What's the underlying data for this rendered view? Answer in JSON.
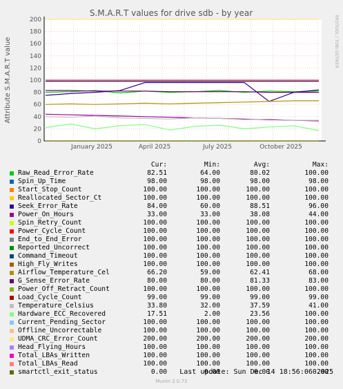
{
  "chart_data": {
    "type": "line",
    "title": "S.M.A.R.T values for drive sdb - by year",
    "ylabel": "Attribute S.M.A.R.T value",
    "ylim": [
      0,
      200
    ],
    "yticks": [
      "0",
      "20",
      "40",
      "60",
      "80",
      "100",
      "120",
      "140",
      "160",
      "180",
      "200"
    ],
    "xticks": [
      "January 2025",
      "April 2025",
      "July 2025",
      "October 2025"
    ],
    "grid": true,
    "side_text": "RRDTOOL / TOBI OETIKER",
    "series": [
      {
        "name": "Raw_Read_Error_Rate",
        "color": "#00cc00",
        "cur": "82.51",
        "min": "64.00",
        "avg": "80.02",
        "max": "100.00",
        "values": [
          80,
          81,
          83,
          79,
          82,
          80,
          81,
          83,
          80,
          82,
          81,
          82
        ]
      },
      {
        "name": "Spin_Up_Time",
        "color": "#0066b3",
        "cur": "98.00",
        "min": "98.00",
        "avg": "98.00",
        "max": "98.00",
        "values": [
          98,
          98,
          98,
          98,
          98,
          98,
          98,
          98,
          98,
          98,
          98,
          98
        ]
      },
      {
        "name": "Start_Stop_Count",
        "color": "#ff8000",
        "cur": "100.00",
        "min": "100.00",
        "avg": "100.00",
        "max": "100.00",
        "values": [
          100,
          100,
          100,
          100,
          100,
          100,
          100,
          100,
          100,
          100,
          100,
          100
        ]
      },
      {
        "name": "Reallocated_Sector_Ct",
        "color": "#ffcc00",
        "cur": "100.00",
        "min": "100.00",
        "avg": "100.00",
        "max": "100.00",
        "values": [
          100,
          100,
          100,
          100,
          100,
          100,
          100,
          100,
          100,
          100,
          100,
          100
        ]
      },
      {
        "name": "Seek_Error_Rate",
        "color": "#330099",
        "cur": "84.00",
        "min": "60.00",
        "avg": "88.51",
        "max": "96.00",
        "values": [
          75,
          78,
          80,
          83,
          96,
          96,
          96,
          96,
          96,
          65,
          80,
          84
        ]
      },
      {
        "name": "Power_On_Hours",
        "color": "#990099",
        "cur": "33.00",
        "min": "33.00",
        "avg": "38.08",
        "max": "44.00",
        "values": [
          44,
          43,
          42,
          41,
          40,
          39,
          38,
          37,
          36,
          35,
          34,
          33
        ]
      },
      {
        "name": "Spin_Retry_Count",
        "color": "#ccff00",
        "cur": "100.00",
        "min": "100.00",
        "avg": "100.00",
        "max": "100.00",
        "values": [
          100,
          100,
          100,
          100,
          100,
          100,
          100,
          100,
          100,
          100,
          100,
          100
        ]
      },
      {
        "name": "Power_Cycle_Count",
        "color": "#ff0000",
        "cur": "100.00",
        "min": "100.00",
        "avg": "100.00",
        "max": "100.00",
        "values": [
          100,
          100,
          100,
          100,
          100,
          100,
          100,
          100,
          100,
          100,
          100,
          100
        ]
      },
      {
        "name": "End_to_End_Error",
        "color": "#808080",
        "cur": "100.00",
        "min": "100.00",
        "avg": "100.00",
        "max": "100.00",
        "values": [
          100,
          100,
          100,
          100,
          100,
          100,
          100,
          100,
          100,
          100,
          100,
          100
        ]
      },
      {
        "name": "Reported_Uncorrect",
        "color": "#008f00",
        "cur": "100.00",
        "min": "100.00",
        "avg": "100.00",
        "max": "100.00",
        "values": [
          100,
          100,
          100,
          100,
          100,
          100,
          100,
          100,
          100,
          100,
          100,
          100
        ]
      },
      {
        "name": "Command_Timeout",
        "color": "#00487d",
        "cur": "100.00",
        "min": "100.00",
        "avg": "100.00",
        "max": "100.00",
        "values": [
          100,
          100,
          100,
          100,
          100,
          100,
          100,
          100,
          100,
          100,
          100,
          100
        ]
      },
      {
        "name": "High_Fly_Writes",
        "color": "#b35a00",
        "cur": "100.00",
        "min": "100.00",
        "avg": "100.00",
        "max": "100.00",
        "values": [
          100,
          100,
          100,
          100,
          100,
          100,
          100,
          100,
          100,
          100,
          100,
          100
        ]
      },
      {
        "name": "Airflow_Temperature_Cel",
        "color": "#b38f00",
        "cur": "66.20",
        "min": "59.00",
        "avg": "62.41",
        "max": "68.00",
        "values": [
          60,
          61,
          60,
          61,
          62,
          61,
          62,
          63,
          64,
          65,
          66,
          66
        ]
      },
      {
        "name": "G_Sense_Error_Rate",
        "color": "#6b006b",
        "cur": "80.00",
        "min": "80.00",
        "avg": "81.33",
        "max": "83.00",
        "values": [
          83,
          83,
          82,
          82,
          82,
          81,
          81,
          81,
          81,
          80,
          80,
          80
        ]
      },
      {
        "name": "Power_Off_Retract_Count",
        "color": "#8fb300",
        "cur": "100.00",
        "min": "100.00",
        "avg": "100.00",
        "max": "100.00",
        "values": [
          100,
          100,
          100,
          100,
          100,
          100,
          100,
          100,
          100,
          100,
          100,
          100
        ]
      },
      {
        "name": "Load_Cycle_Count",
        "color": "#b30000",
        "cur": "99.00",
        "min": "99.00",
        "avg": "99.00",
        "max": "99.00",
        "values": [
          99,
          99,
          99,
          99,
          99,
          99,
          99,
          99,
          99,
          99,
          99,
          99
        ]
      },
      {
        "name": "Temperature_Celsius",
        "color": "#bebebe",
        "cur": "33.80",
        "min": "32.00",
        "avg": "37.59",
        "max": "41.00",
        "values": [
          40,
          39,
          41,
          38,
          37,
          36,
          38,
          37,
          35,
          36,
          34,
          34
        ]
      },
      {
        "name": "Hardware_ECC_Recovered",
        "color": "#80ff80",
        "cur": "17.51",
        "min": "2.00",
        "avg": "23.56",
        "max": "100.00",
        "values": [
          22,
          28,
          20,
          25,
          27,
          18,
          24,
          26,
          20,
          23,
          25,
          17
        ]
      },
      {
        "name": "Current_Pending_Sector",
        "color": "#80c9ff",
        "cur": "100.00",
        "min": "100.00",
        "avg": "100.00",
        "max": "100.00",
        "values": [
          100,
          100,
          100,
          100,
          100,
          100,
          100,
          100,
          100,
          100,
          100,
          100
        ]
      },
      {
        "name": "Offline_Uncorrectable",
        "color": "#ffc080",
        "cur": "100.00",
        "min": "100.00",
        "avg": "100.00",
        "max": "100.00",
        "values": [
          100,
          100,
          100,
          100,
          100,
          100,
          100,
          100,
          100,
          100,
          100,
          100
        ]
      },
      {
        "name": "UDMA_CRC_Error_Count",
        "color": "#ffe680",
        "cur": "200.00",
        "min": "200.00",
        "avg": "200.00",
        "max": "200.00",
        "values": [
          200,
          200,
          200,
          200,
          200,
          200,
          200,
          200,
          200,
          200,
          200,
          200
        ]
      },
      {
        "name": "Head_Flying_Hours",
        "color": "#aa80ff",
        "cur": "100.00",
        "min": "100.00",
        "avg": "100.00",
        "max": "100.00",
        "values": [
          100,
          100,
          100,
          100,
          100,
          100,
          100,
          100,
          100,
          100,
          100,
          100
        ]
      },
      {
        "name": "Total_LBAs_Written",
        "color": "#ee00cc",
        "cur": "100.00",
        "min": "100.00",
        "avg": "100.00",
        "max": "100.00",
        "values": [
          100,
          100,
          100,
          100,
          100,
          100,
          100,
          100,
          100,
          100,
          100,
          100
        ]
      },
      {
        "name": "Total_LBAs_Read",
        "color": "#ff8080",
        "cur": "100.00",
        "min": "100.00",
        "avg": "100.00",
        "max": "100.00",
        "values": [
          100,
          100,
          100,
          100,
          100,
          100,
          100,
          100,
          100,
          100,
          100,
          100
        ]
      },
      {
        "name": "smartctl_exit_status",
        "color": "#666600",
        "cur": "0.00",
        "min": "0.00",
        "avg": "0.00",
        "max": "0.00",
        "values": [
          0,
          0,
          0,
          0,
          0,
          0,
          0,
          0,
          0,
          0,
          0,
          0
        ]
      }
    ]
  },
  "legend_headers": {
    "cur": "Cur:",
    "min": "Min:",
    "avg": "Avg:",
    "max": "Max:"
  },
  "last_update": "Last update: Sun Dec 14 18:56:06 2025",
  "footer": "Munin 2.0.73"
}
